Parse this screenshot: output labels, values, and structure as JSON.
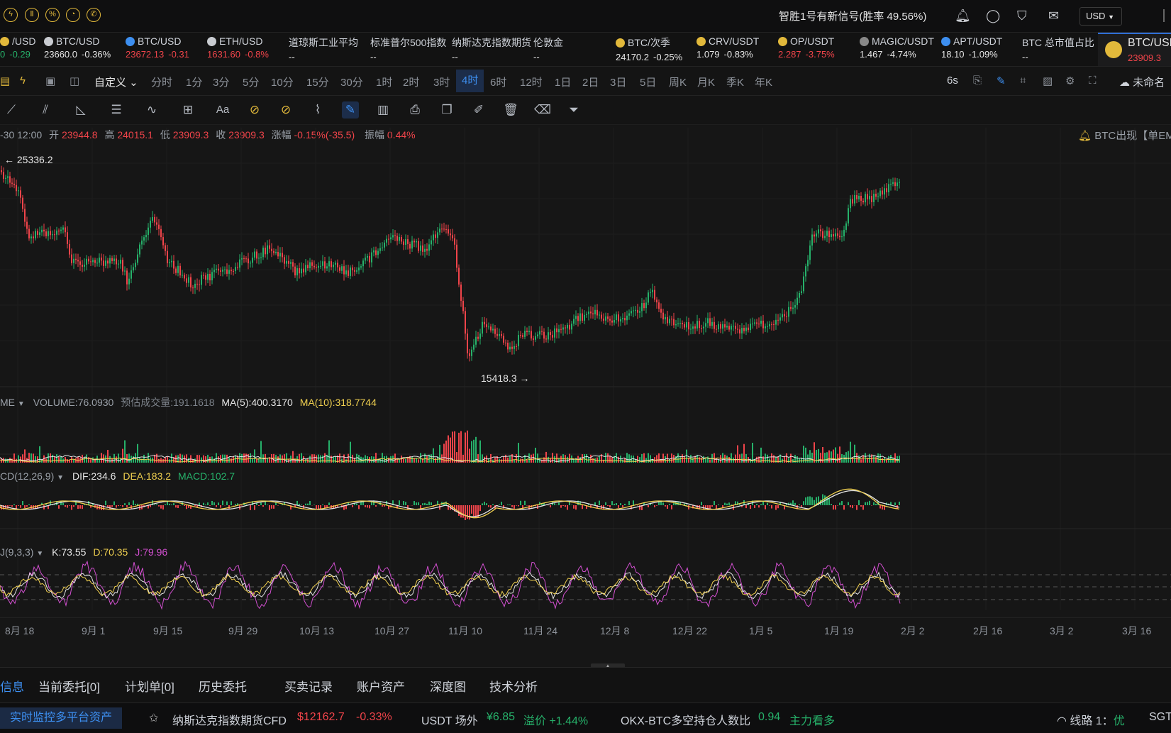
{
  "topbar": {
    "signal_text": "智胜1号有新信号(胜率 49.56%)",
    "currency": "USD"
  },
  "tickers": [
    {
      "name": "/USD",
      "price": "0",
      "change": "-0.29",
      "dir": "green"
    },
    {
      "name": "BTC/USD",
      "price": "23660.0",
      "change": "-0.36%",
      "dir": "white"
    },
    {
      "name": "BTC/USD",
      "price": "23672.13",
      "change": "-0.31",
      "dir": "red"
    },
    {
      "name": "ETH/USD",
      "price": "1631.60",
      "change": "-0.8%",
      "dir": "red"
    },
    {
      "name": "道琼斯工业平均",
      "price": "--",
      "change": "",
      "dir": "white"
    },
    {
      "name": "标准普尔500指数",
      "price": "--",
      "change": "",
      "dir": "white"
    },
    {
      "name": "纳斯达克指数期货",
      "price": "--",
      "change": "",
      "dir": "white"
    },
    {
      "name": "伦敦金",
      "price": "--",
      "change": "",
      "dir": "white"
    },
    {
      "name": "BTC/次季",
      "price": "24170.2",
      "change": "-0.25%",
      "dir": "white"
    },
    {
      "name": "CRV/USDT",
      "price": "1.079",
      "change": "-0.83%",
      "dir": "white"
    },
    {
      "name": "OP/USDT",
      "price": "2.287",
      "change": "-3.75%",
      "dir": "red"
    },
    {
      "name": "MAGIC/USDT",
      "price": "1.467",
      "change": "-4.74%",
      "dir": "white"
    },
    {
      "name": "APT/USDT",
      "price": "18.10",
      "change": "-1.09%",
      "dir": "white"
    },
    {
      "name": "BTC 总市值占比",
      "price": "--",
      "change": "",
      "dir": "white"
    }
  ],
  "active_tab": {
    "name": "BTC/USDT",
    "price": "23909.3"
  },
  "intervals": [
    "分时",
    "1分",
    "3分",
    "5分",
    "10分",
    "15分",
    "30分",
    "1时",
    "2时",
    "3时",
    "4时",
    "6时",
    "12时",
    "1日",
    "2日",
    "3日",
    "5日",
    "周K",
    "月K",
    "季K",
    "年K"
  ],
  "active_interval": "4时",
  "custom_label": "自定义",
  "refresh_rate": "6s",
  "layout_name": "未命名",
  "ohlc": {
    "date": "-30 12:00",
    "open_label": "开",
    "open": "23944.8",
    "high_label": "高",
    "high": "24015.1",
    "low_label": "低",
    "low": "23909.3",
    "close_label": "收",
    "close": "23909.3",
    "change_label": "涨幅",
    "change": "-0.15%(-35.5)",
    "amp_label": "振幅",
    "amp": "0.44%"
  },
  "alert_text": "BTC出现【单EM",
  "price_marks": {
    "high": "← 25336.2",
    "low": "15418.3 →"
  },
  "volume": {
    "name": "ME",
    "volume": "VOLUME:76.0930",
    "est_label": "预估成交量:191.1618",
    "ma5": "MA(5):400.3170",
    "ma10": "MA(10):318.7744"
  },
  "macd": {
    "name": "CD(12,26,9)",
    "dif": "DIF:234.6",
    "dea": "DEA:183.2",
    "macd": "MACD:102.7"
  },
  "kdj": {
    "name": "J(9,3,3)",
    "k": "K:73.55",
    "d": "D:70.35",
    "j": "J:79.96"
  },
  "xaxis": [
    "8月 18",
    "9月 1",
    "9月 15",
    "9月 29",
    "10月 13",
    "10月 27",
    "11月 10",
    "11月 24",
    "12月 8",
    "12月 22",
    "1月 5",
    "1月 19",
    "2月 2",
    "2月 16",
    "3月 2",
    "3月 16"
  ],
  "bottom_tabs": [
    "信息",
    "当前委托[0]",
    "计划单[0]",
    "历史委托",
    "买卖记录",
    "账户资产",
    "深度图",
    "技术分析"
  ],
  "status": {
    "monitor": "实时监控多平台资产",
    "nasdaq_label": "纳斯达克指数期货CFD",
    "nasdaq_price": "$12162.7",
    "nasdaq_change": "-0.33%",
    "usdt_label": "USDT 场外",
    "usdt_price": "¥6.85",
    "usdt_premium": "溢价 +1.44%",
    "okx_label": "OKX-BTC多空持仓人数比",
    "okx_value": "0.94",
    "okx_sentiment": "主力看多",
    "line_label": "线路 1：",
    "line_quality": "优",
    "tz": "SGT"
  },
  "colors": {
    "up": "#26b16a",
    "down": "#f0444a",
    "accent": "#3d8ff0",
    "gold": "#e2b93b",
    "dea": "#f0d050",
    "kdj_j": "#d24fd0"
  }
}
